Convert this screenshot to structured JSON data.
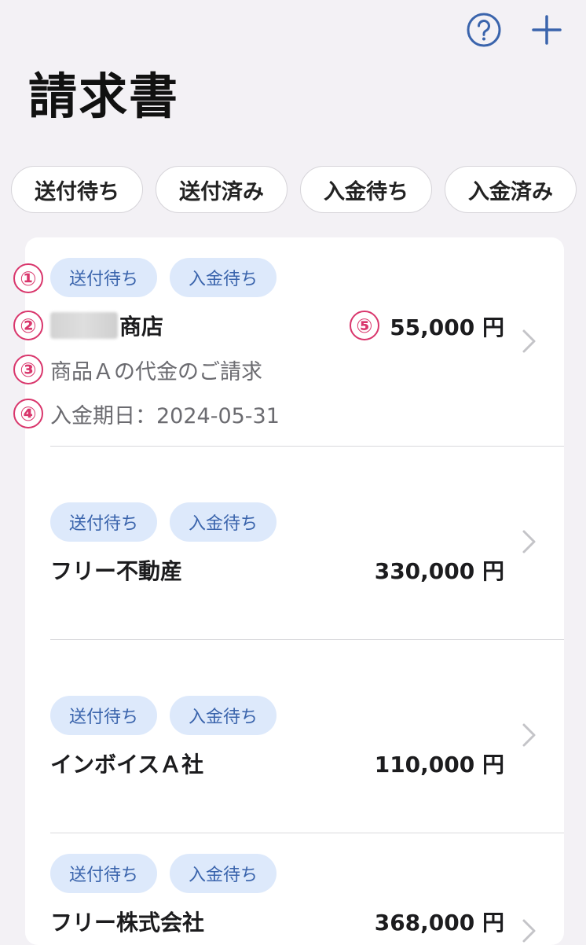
{
  "header": {
    "help_icon": "question-circle-icon",
    "add_icon": "plus-icon",
    "title": "請求書",
    "accent_color": "#3a64ac"
  },
  "filters": [
    {
      "label": "送付待ち"
    },
    {
      "label": "送付済み"
    },
    {
      "label": "入金待ち"
    },
    {
      "label": "入金済み"
    }
  ],
  "invoices": [
    {
      "badges": [
        "送付待ち",
        "入金待ち"
      ],
      "client": "商店",
      "client_redacted": true,
      "amount": "55,000 円",
      "subtitle": "商品Ａの代金のご請求",
      "due": "入金期日：2024-05-31"
    },
    {
      "badges": [
        "送付待ち",
        "入金待ち"
      ],
      "client": "フリー不動産",
      "amount": "330,000 円"
    },
    {
      "badges": [
        "送付待ち",
        "入金待ち"
      ],
      "client": "インボイスＡ社",
      "amount": "110,000 円"
    },
    {
      "badges": [
        "送付待ち",
        "入金待ち"
      ],
      "client": "フリー株式会社",
      "amount": "368,000 円"
    }
  ],
  "annotations": {
    "status": "①",
    "client": "②",
    "subtitle": "③",
    "due": "④",
    "amount": "⑤",
    "color": "#d9366c"
  }
}
